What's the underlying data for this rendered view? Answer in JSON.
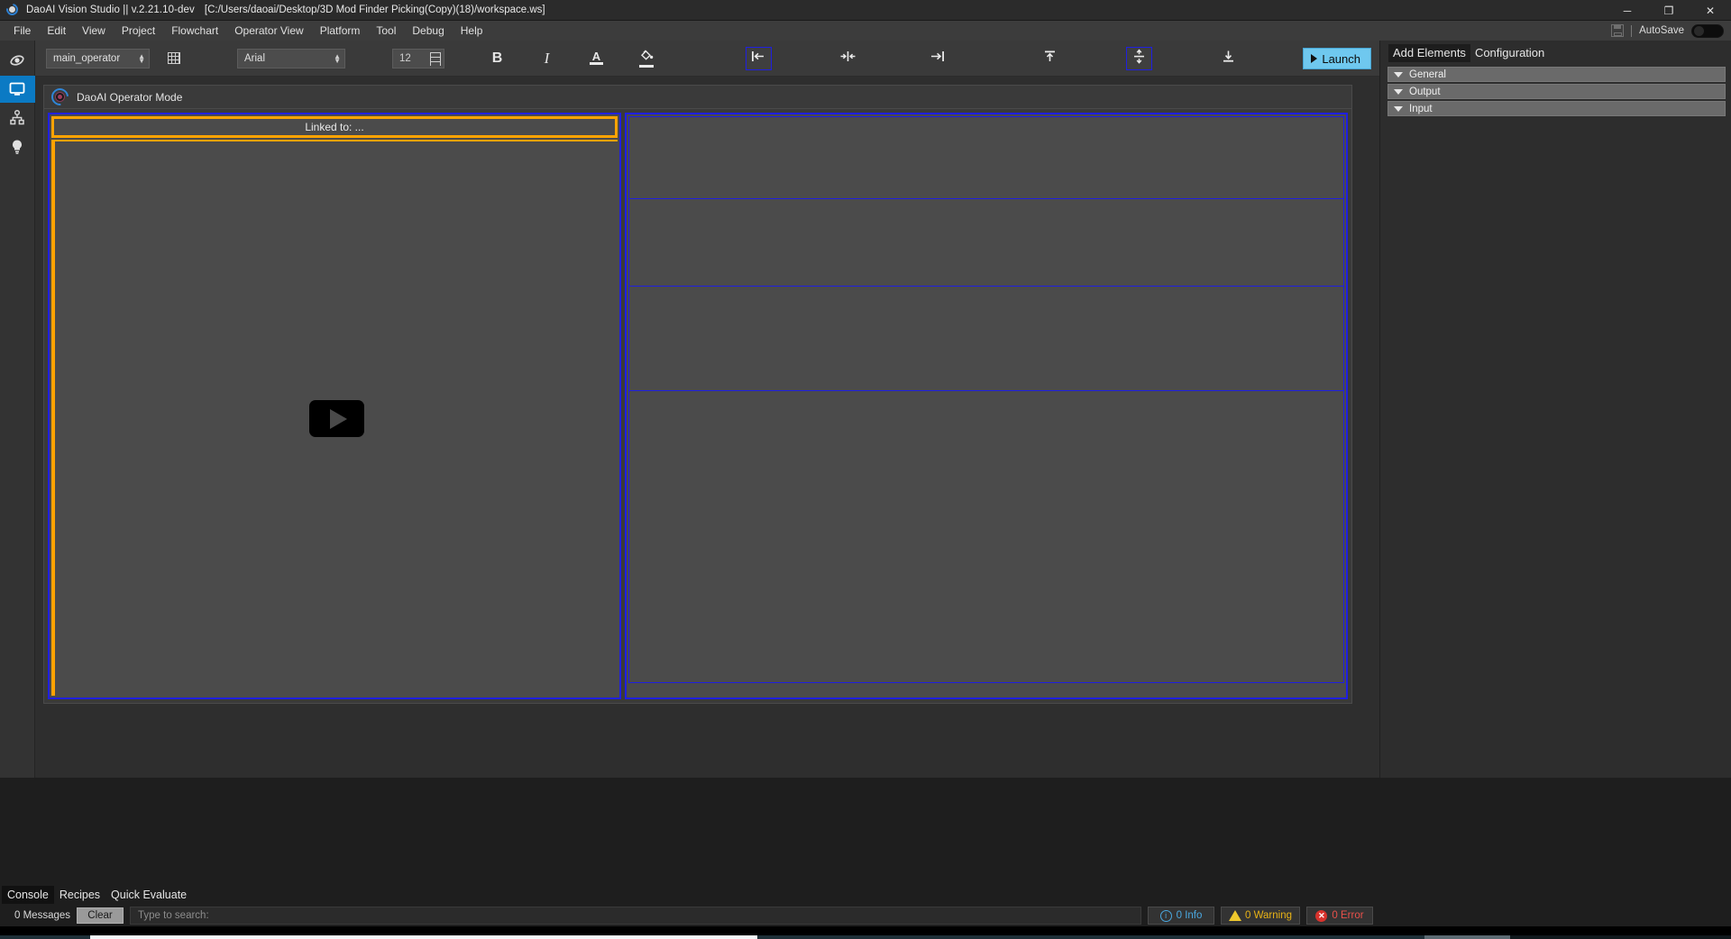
{
  "window": {
    "app_icon": "daoai-eye-icon",
    "title": "DaoAI Vision Studio || v.2.21.10-dev",
    "file_path": "[C:/Users/daoai/Desktop/3D Mod Finder Picking(Copy)(18)/workspace.ws]",
    "controls": {
      "minimize": "─",
      "maximize": "❐",
      "close": "✕"
    }
  },
  "menubar": {
    "items": [
      "File",
      "Edit",
      "View",
      "Project",
      "Flowchart",
      "Operator View",
      "Platform",
      "Tool",
      "Debug",
      "Help"
    ],
    "autosave": {
      "icon": "save-floppy-icon",
      "label": "AutoSave",
      "state": "off"
    }
  },
  "rail": {
    "items": [
      {
        "name": "vision-icon",
        "label": "Vision",
        "active": false
      },
      {
        "name": "monitor-icon",
        "label": "Operator View",
        "active": true
      },
      {
        "name": "hierarchy-icon",
        "label": "Flowchart",
        "active": false
      },
      {
        "name": "lightbulb-icon",
        "label": "Insights",
        "active": false
      }
    ]
  },
  "toolbar": {
    "operator_select": {
      "value": "main_operator",
      "placeholder": "main_operator"
    },
    "grid_button": "grid-icon",
    "font_select": {
      "value": "Arial"
    },
    "font_size": {
      "value": "12"
    },
    "bold": "B",
    "italic": "I",
    "font_color": "A",
    "fill_color": "fill-bucket-icon",
    "align_left": "align-left-icon",
    "align_center_h": "align-center-horizontal-icon",
    "align_right": "align-right-icon",
    "align_top": "align-top-icon",
    "align_center_v": "align-center-vertical-icon",
    "align_bottom": "align-bottom-icon",
    "layout": "layout-grid-icon",
    "launch": {
      "label": "Launch",
      "icon": "play-icon"
    },
    "selected": [
      "align_left",
      "align_center_v"
    ]
  },
  "operator_panel": {
    "logo": "daoai-logo-icon",
    "title": "DaoAI Operator Mode",
    "left_widget": {
      "linked_label": "Linked to: ...",
      "video": {
        "placeholder_icon": "play-icon"
      }
    },
    "right_widget": {
      "cells": [
        "cell-1",
        "cell-2",
        "cell-3",
        "cell-4"
      ]
    }
  },
  "dock": {
    "tabs": [
      {
        "label": "Add Elements",
        "active": true
      },
      {
        "label": "Configuration",
        "active": false
      }
    ],
    "sections": [
      {
        "label": "General",
        "expanded": true
      },
      {
        "label": "Output",
        "expanded": true
      },
      {
        "label": "Input",
        "expanded": true
      }
    ]
  },
  "console": {
    "tabs": [
      {
        "label": "Console",
        "active": true
      },
      {
        "label": "Recipes",
        "active": false
      },
      {
        "label": "Quick Evaluate",
        "active": false
      }
    ],
    "message_count": "0 Messages",
    "clear_label": "Clear",
    "search_placeholder": "Type to search:",
    "chips": [
      {
        "name": "info-chip",
        "icon": "info-icon",
        "label": "0 Info",
        "color": "#4aa8e0"
      },
      {
        "name": "warning-chip",
        "icon": "warning-icon",
        "label": "0 Warning",
        "color": "#e8b317"
      },
      {
        "name": "error-chip",
        "icon": "error-icon",
        "label": "0 Error",
        "color": "#e8504a"
      }
    ]
  },
  "colors": {
    "accent_blue": "#0b7ac4",
    "selection_blue": "#1f1fe0",
    "highlight_orange": "#ffa300",
    "launch_cyan": "#6fc8ef"
  }
}
